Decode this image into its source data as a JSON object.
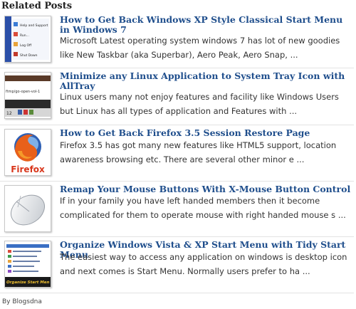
{
  "heading": "Related Posts",
  "posts": [
    {
      "title": "How to Get Back Windows XP Style Classical Start Menu in Windows 7",
      "excerpt": "Microsoft Latest operating system windows 7 has lot of new goodies like New Taskbar (aka Superbar), Aero Peak, Aero Snap, ...",
      "thumb": {
        "icon": "start-menu-screenshot",
        "menu_items": [
          "Help and Support",
          "Run...",
          "Log Off",
          "Shut Down"
        ]
      }
    },
    {
      "title": "Minimize any Linux Application to System Tray Icon with AllTray",
      "excerpt": "Linux users many not enjoy features and facility like Windows Users but Linux has all types of application and Features with ...",
      "thumb": {
        "icon": "terminal-screenshot",
        "path_text": "ftmp/go-open-vol-1",
        "time_text": "12"
      }
    },
    {
      "title": "How to Get Back Firefox 3.5 Session Restore Page",
      "excerpt": "Firefox 3.5 has got many new features like HTML5 support, location awareness browsing etc. There are several other minor e ...",
      "thumb": {
        "icon": "firefox-logo",
        "wordmark": "Firefox"
      }
    },
    {
      "title": "Remap Your Mouse Buttons With X-Mouse Button Control",
      "excerpt": "If in your family you have left handed members then it become complicated for them to operate mouse with right handed mouse  s ...",
      "thumb": {
        "icon": "computer-mouse"
      }
    },
    {
      "title": "Organize Windows Vista & XP Start Menu with Tidy Start Menu",
      "excerpt": "The easiest way to access any application on windows is desktop icon and next comes is Start Menu. Normally users prefer to ha ...",
      "thumb": {
        "icon": "tidy-start-menu-screenshot",
        "caption": "Organize Start Men"
      }
    }
  ],
  "credit": "By Blogsdna",
  "colors": {
    "title": "#1f4e8c",
    "excerpt": "#333333",
    "heading": "#222222",
    "divider": "#e3e3e3"
  }
}
